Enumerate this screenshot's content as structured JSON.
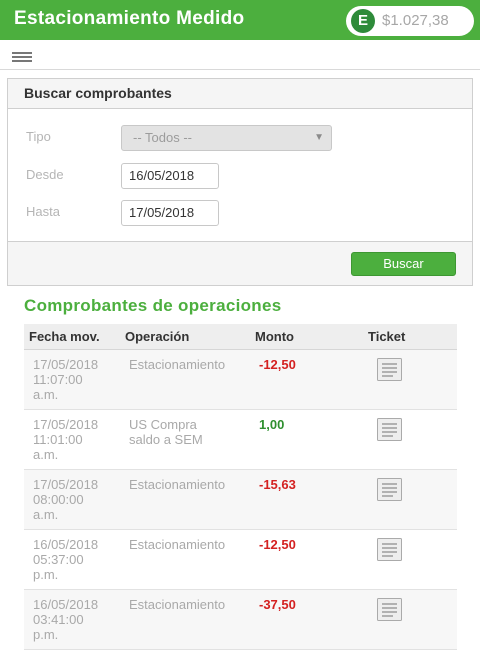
{
  "app": {
    "title": "Estacionamiento Medido",
    "balance": "$1.027,38",
    "balance_icon": "E"
  },
  "search_panel": {
    "title": "Buscar comprobantes",
    "tipo_label": "Tipo",
    "tipo_value": "-- Todos --",
    "desde_label": "Desde",
    "desde_value": "16/05/2018",
    "hasta_label": "Hasta",
    "hasta_value": "17/05/2018",
    "search_button": "Buscar"
  },
  "operations": {
    "title": "Comprobantes de operaciones",
    "columns": [
      "Fecha mov.",
      "Operación",
      "Monto",
      "Ticket"
    ],
    "rows": [
      {
        "date": "17/05/2018\n11:07:00\na.m.",
        "operation": "Estacionamiento",
        "amount": "-12,50",
        "type": "neg"
      },
      {
        "date": "17/05/2018\n11:01:00\na.m.",
        "operation": "US Compra\nsaldo a SEM",
        "amount": "1,00",
        "type": "pos"
      },
      {
        "date": "17/05/2018\n08:00:00\na.m.",
        "operation": "Estacionamiento",
        "amount": "-15,63",
        "type": "neg"
      },
      {
        "date": "16/05/2018\n05:37:00\np.m.",
        "operation": "Estacionamiento",
        "amount": "-12,50",
        "type": "neg"
      },
      {
        "date": "16/05/2018\n03:41:00\np.m.",
        "operation": "Estacionamiento",
        "amount": "-37,50",
        "type": "neg"
      }
    ]
  },
  "colors": {
    "brand": "#4caf3e",
    "negative": "#d42121",
    "positive": "#2f8f2f"
  }
}
